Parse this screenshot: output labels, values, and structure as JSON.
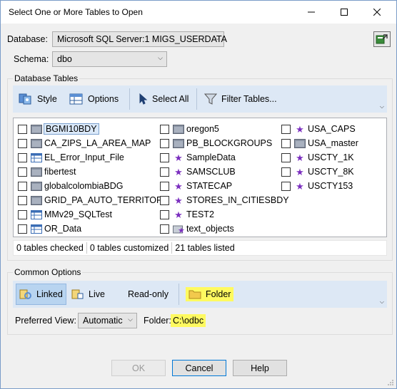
{
  "window": {
    "title": "Select One or More Tables to Open"
  },
  "database": {
    "label": "Database:",
    "value": "Microsoft SQL Server:1 MIGS_USERDATA"
  },
  "schema": {
    "label": "Schema:",
    "value": "dbo"
  },
  "tables_group": {
    "title": "Database Tables",
    "toolbar": {
      "style": "Style",
      "options": "Options",
      "select_all": "Select All",
      "filter": "Filter Tables..."
    }
  },
  "tables": {
    "col1": [
      {
        "name": "BGMI10BDY",
        "icon": "folder-icon",
        "selected": true
      },
      {
        "name": "CA_ZIPS_LA_AREA_MAP",
        "icon": "folder-icon"
      },
      {
        "name": "EL_Error_Input_File",
        "icon": "table-icon"
      },
      {
        "name": "fibertest",
        "icon": "folder-icon"
      },
      {
        "name": "globalcolombiaBDG",
        "icon": "folder-icon"
      },
      {
        "name": "GRID_PA_AUTO_TERRITORY",
        "icon": "folder-icon"
      },
      {
        "name": "MMv29_SQLTest",
        "icon": "table-icon"
      },
      {
        "name": "OR_Data",
        "icon": "table-icon"
      }
    ],
    "col2": [
      {
        "name": "oregon5",
        "icon": "folder-icon"
      },
      {
        "name": "PB_BLOCKGROUPS",
        "icon": "folder-icon"
      },
      {
        "name": "SampleData",
        "icon": "star-icon"
      },
      {
        "name": "SAMSCLUB",
        "icon": "star-icon"
      },
      {
        "name": "STATECAP",
        "icon": "star-icon"
      },
      {
        "name": "STORES_IN_CITIESBDY",
        "icon": "star-icon"
      },
      {
        "name": "TEST2",
        "icon": "star-icon"
      },
      {
        "name": "text_objects",
        "icon": "map-star-icon"
      }
    ],
    "col3": [
      {
        "name": "USA_CAPS",
        "icon": "star-icon"
      },
      {
        "name": "USA_master",
        "icon": "folder-icon"
      },
      {
        "name": "USCTY_1K",
        "icon": "star-icon"
      },
      {
        "name": "USCTY_8K",
        "icon": "star-icon"
      },
      {
        "name": "USCTY153",
        "icon": "star-icon"
      }
    ]
  },
  "status": {
    "checked": "0 tables checked",
    "customized": "0 tables customized",
    "listed": "21 tables listed"
  },
  "common_options": {
    "title": "Common Options",
    "linked": "Linked",
    "live": "Live",
    "read_only": "Read-only",
    "folder": "Folder",
    "preferred_view_label": "Preferred View:",
    "preferred_view_value": "Automatic",
    "folder_label": "Folder:",
    "folder_value": "C:\\odbc"
  },
  "buttons": {
    "ok": "OK",
    "cancel": "Cancel",
    "help": "Help"
  },
  "colors": {
    "highlight": "#fffa60",
    "toolbar_bg": "#dde8f5",
    "star": "#7b2fbf"
  }
}
